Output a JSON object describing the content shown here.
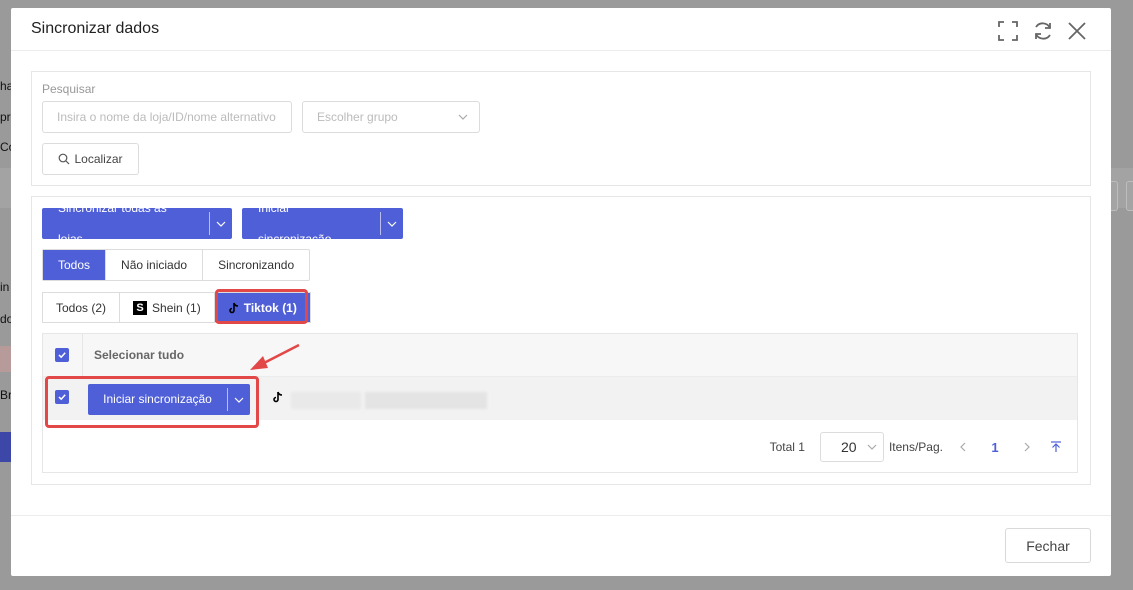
{
  "background": {
    "fragments": [
      "ha",
      "pr",
      "Co",
      "in",
      "do",
      "Br"
    ]
  },
  "modal": {
    "title": "Sincronizar dados",
    "icons": [
      "fullscreen-icon",
      "refresh-icon",
      "close-icon"
    ],
    "search": {
      "label": "Pesquisar",
      "store_placeholder": "Insira o nome da loja/ID/nome alternativo",
      "group_placeholder": "Escolher grupo",
      "find_label": "Localizar"
    },
    "actions": {
      "sync_all_label": "Sincronizar todas as lojas",
      "start_sync_label": "Iniciar sincronização"
    },
    "status_filter": {
      "options": [
        "Todos",
        "Não iniciado",
        "Sincronizando"
      ],
      "active": "Todos"
    },
    "platform_tabs": [
      {
        "label": "Todos (2)",
        "icon": ""
      },
      {
        "label": "Shein (1)",
        "icon": "shein-logo-icon"
      },
      {
        "label": "Tiktok (1)",
        "icon": "tiktok-logo-icon"
      }
    ],
    "table": {
      "select_all_label": "Selecionar tudo",
      "rows": [
        {
          "checked": true,
          "button_label": "Iniciar sincronização",
          "platform_icon": "tiktok-logo-icon"
        }
      ]
    },
    "pagination": {
      "total_label": "Total 1",
      "page_size": "20",
      "per_page_label": "Itens/Pag.",
      "current_page": "1"
    },
    "footer": {
      "close_label": "Fechar"
    }
  },
  "colors": {
    "primary": "#4f5fd8",
    "highlight": "#e34848"
  }
}
